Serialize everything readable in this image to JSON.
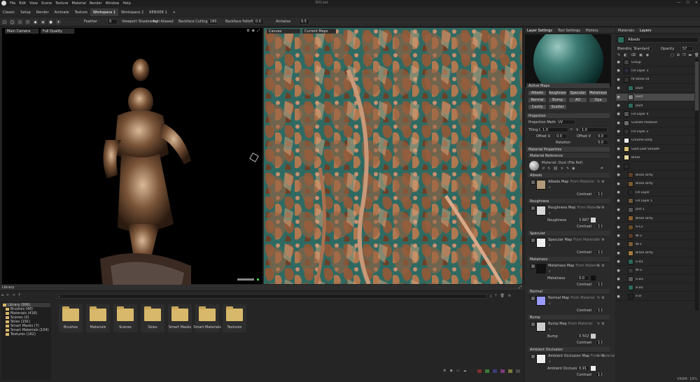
{
  "app": {
    "title": "3DCoat"
  },
  "menubar": [
    "File",
    "Edit",
    "View",
    "Scene",
    "Texture",
    "Material",
    "Render",
    "Window",
    "Help"
  ],
  "workspaces": [
    "Classic",
    "Setup",
    "Render",
    "Animate",
    "Texture",
    "Workspace 1",
    "Workspace 2",
    "RENDER 1",
    "+"
  ],
  "toolbar": {
    "feather_label": "Feather",
    "feather_value": "0",
    "viewport_shadowing": "Viewport Shadowing",
    "anti_aliased": "Anti Aliased",
    "size_value": "180.0",
    "backface_culling": "Backface Culling",
    "opacity_value": "0.0",
    "backface_falloff": "Backface Falloff",
    "falloff_value": "0.0",
    "antialias_label": "Antialias",
    "antialias_value": "0.5"
  },
  "viewport3d": {
    "camera": "Main Camera",
    "quality": "Full Quality"
  },
  "viewport2d": {
    "canvas": "Canvas",
    "map": "Current Maps"
  },
  "library": {
    "title": "Library",
    "tree": [
      {
        "label": "Library (996)"
      },
      {
        "label": "Brushes (48)"
      },
      {
        "label": "Materials (418)"
      },
      {
        "label": "Scenes (0)"
      },
      {
        "label": "Skies (191)"
      },
      {
        "label": "Smart Masks (7)"
      },
      {
        "label": "Smart Materials (104)"
      },
      {
        "label": "Textures (162)"
      }
    ],
    "folders": [
      "Brushes",
      "Materials",
      "Scenes",
      "Skies",
      "Smart Masks",
      "Smart Materials",
      "Textures"
    ],
    "swatch_colors": [
      "#803030",
      "#3b7a3b",
      "#3b3b7a",
      "#7a3b7a",
      "#7a7a3b",
      "#4a4a4a"
    ]
  },
  "layer_settings": {
    "tabs": [
      "Layer Settings",
      "Tool Settings",
      "History"
    ],
    "active_maps_title": "Active Maps",
    "map_buttons": [
      "Albedo",
      "Roughness",
      "Specular",
      "Metalness",
      "Normal",
      "Bump",
      "AO",
      "Opa",
      "Cavity",
      "Scatter"
    ],
    "projection_title": "Projection",
    "projection_method_label": "Projection Method",
    "projection_method": "UV",
    "tiling_label": "Tiling U",
    "tiling_u": "1.0",
    "tiling_v": "1.0",
    "tiling_v_label": "V",
    "offset_u_label": "Offset U",
    "offset_u": "0.0",
    "offset_v_label": "Offset V",
    "offset_v": "0.0",
    "rotation_label": "Rotation",
    "rotation": "0.0",
    "material_props_title": "Material Properties",
    "material_reference_title": "Material Reference",
    "material_ref_value": "Material: Dust (File Ref)",
    "sections": [
      {
        "title": "Albedo",
        "map_label": "Albedo Map",
        "from": "From Material",
        "value_label": "Contrast",
        "value": "1.0",
        "color": "#b09a7a"
      },
      {
        "title": "Roughness",
        "map_label": "Roughness Map",
        "from": "From Material",
        "param_label": "Roughness",
        "param": "0.687",
        "value_label": "Contrast",
        "value": "1.0",
        "color": "#d8d8d8"
      },
      {
        "title": "Specular",
        "map_label": "Specular Map",
        "from": "From Material",
        "value_label": "Contrast",
        "value": "1.0",
        "color": "#eeeeee"
      },
      {
        "title": "Metalness",
        "map_label": "Metalness Map",
        "from": "From Material",
        "param_label": "Metalness",
        "param": "0.0",
        "value_label": "Contrast",
        "value": "1.0",
        "color": "#111111"
      },
      {
        "title": "Normal",
        "map_label": "Normal Map",
        "from": "From Material",
        "value_label": "Contrast",
        "value": "1.0",
        "color": "#9a9aff"
      },
      {
        "title": "Bump",
        "map_label": "Bump Map",
        "from": "From Material",
        "param_label": "Bump",
        "param": "0.502",
        "value_label": "Contrast",
        "value": "1.0",
        "color": "#cccccc"
      },
      {
        "title": "Ambient Occlusion",
        "map_label": "Ambient Occlusion Map",
        "from": "From Material",
        "param_label": "Ambient Occlusion",
        "param": "0.91",
        "value_label": "Contrast",
        "value": "1.0",
        "color": "#eeeeee"
      }
    ]
  },
  "layers_panel": {
    "tabs": [
      "Materials",
      "Layers"
    ],
    "current": "Albedo",
    "blending_label": "Blending",
    "blending_mode": "Standard",
    "opacity_label": "Opacity",
    "opacity": "57",
    "items": [
      {
        "name": "Group",
        "color": "#444444"
      },
      {
        "name": "Fill Layer 3",
        "color": "#2a2a3a"
      },
      {
        "name": "fit stone cd",
        "color": "#333333"
      },
      {
        "name": "Dust",
        "color": "#2e6a5e"
      },
      {
        "name": "Dust",
        "color": "#888888"
      },
      {
        "name": "Dust",
        "color": "#2e6a5e"
      },
      {
        "name": "Fill Layer 4",
        "color": "#555555"
      },
      {
        "name": "Granite Polished",
        "color": "#6a6a6a"
      },
      {
        "name": "Fill Layer 2",
        "color": "#333333"
      },
      {
        "name": "Chrome Dirty",
        "color": "#eeeeee"
      },
      {
        "name": "Gold Leaf Smooth",
        "color": "#d8c070"
      },
      {
        "name": "Brass",
        "color": "#e8d8a0"
      },
      {
        "name": "",
        "color": "#2a2a2a"
      },
      {
        "name": "Brass Dirty",
        "color": "#5a4028"
      },
      {
        "name": "Brass Dirty",
        "color": "#7a5a30"
      },
      {
        "name": "Fill Layer",
        "color": "#2a2a2a"
      },
      {
        "name": "Fill Layer 1",
        "color": "#6a5a3a"
      },
      {
        "name": "Dirt 1",
        "color": "#555555"
      },
      {
        "name": "Brass Dirty",
        "color": "#8a6030"
      },
      {
        "name": "S-C2",
        "color": "#6a4a2a"
      },
      {
        "name": "W-3",
        "color": "#5a3a2a"
      },
      {
        "name": "W-1",
        "color": "#7a5a3a"
      },
      {
        "name": "Brass Dirty",
        "color": "#a07a40"
      },
      {
        "name": "S-D1",
        "color": "#2e6a5e"
      },
      {
        "name": "W-3",
        "color": "#3a3a3a"
      },
      {
        "name": "S-D3",
        "color": "#5a5a5a"
      },
      {
        "name": "S-D2",
        "color": "#2e6a5e"
      },
      {
        "name": "S-D",
        "color": "#222222"
      }
    ]
  },
  "status": {
    "vram": "VRAM: 19%"
  }
}
